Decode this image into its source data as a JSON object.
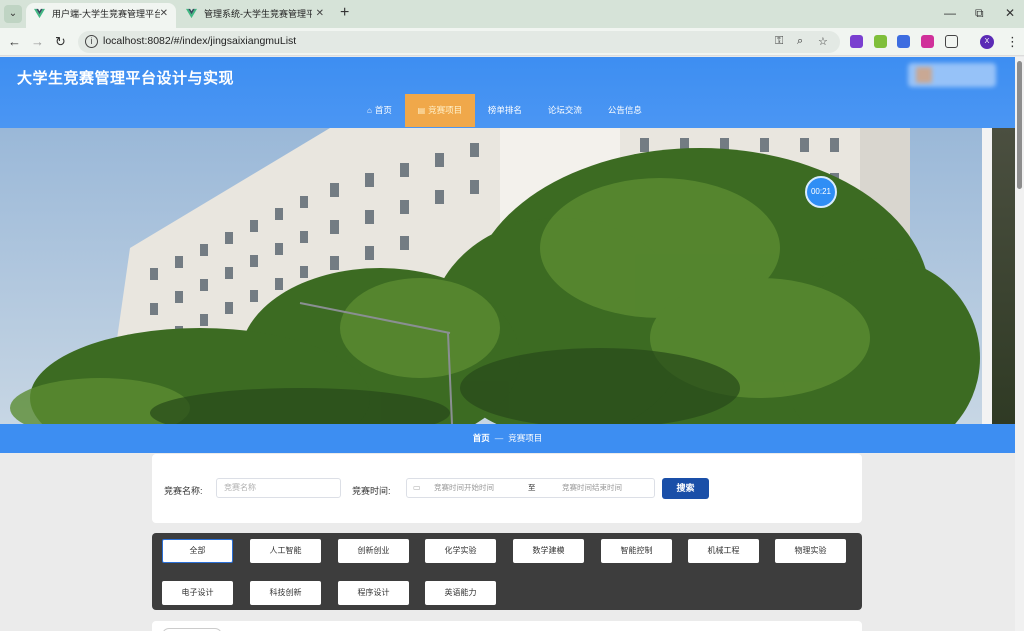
{
  "browser": {
    "tabs": [
      {
        "title": "用户端-大学生竞赛管理平台设计与实现",
        "active": true
      },
      {
        "title": "管理系统-大学生竞赛管理平台设计与实现",
        "active": false
      }
    ],
    "url": "localhost:8082/#/index/jingsaixiangmuList",
    "profile_initial": "X"
  },
  "site": {
    "title": "大学生竞赛管理平台设计与实现"
  },
  "nav": [
    {
      "label": "首页",
      "icon": "home-icon"
    },
    {
      "label": "竞赛项目",
      "icon": "list-icon",
      "active": true
    },
    {
      "label": "榜单排名"
    },
    {
      "label": "论坛交流"
    },
    {
      "label": "公告信息"
    }
  ],
  "banner": {
    "timer": "00:21"
  },
  "breadcrumb": {
    "home": "首页",
    "separator": "—",
    "current": "竞赛项目"
  },
  "search": {
    "name_label": "竞赛名称:",
    "name_placeholder": "竞赛名称",
    "time_label": "竞赛时间:",
    "start_placeholder": "竞赛时间开始时间",
    "range_sep": "至",
    "end_placeholder": "竞赛时间结束时间",
    "button": "搜索"
  },
  "categories": [
    "全部",
    "人工智能",
    "创新创业",
    "化学实验",
    "数学建模",
    "智能控制",
    "机械工程",
    "物理实验",
    "电子设计",
    "科技创新",
    "程序设计",
    "英语能力"
  ],
  "colors": {
    "header": "#3d8ef2",
    "nav_active": "#f0a84a",
    "search_button": "#1a4fa8",
    "category_panel": "#3d3d3d"
  }
}
